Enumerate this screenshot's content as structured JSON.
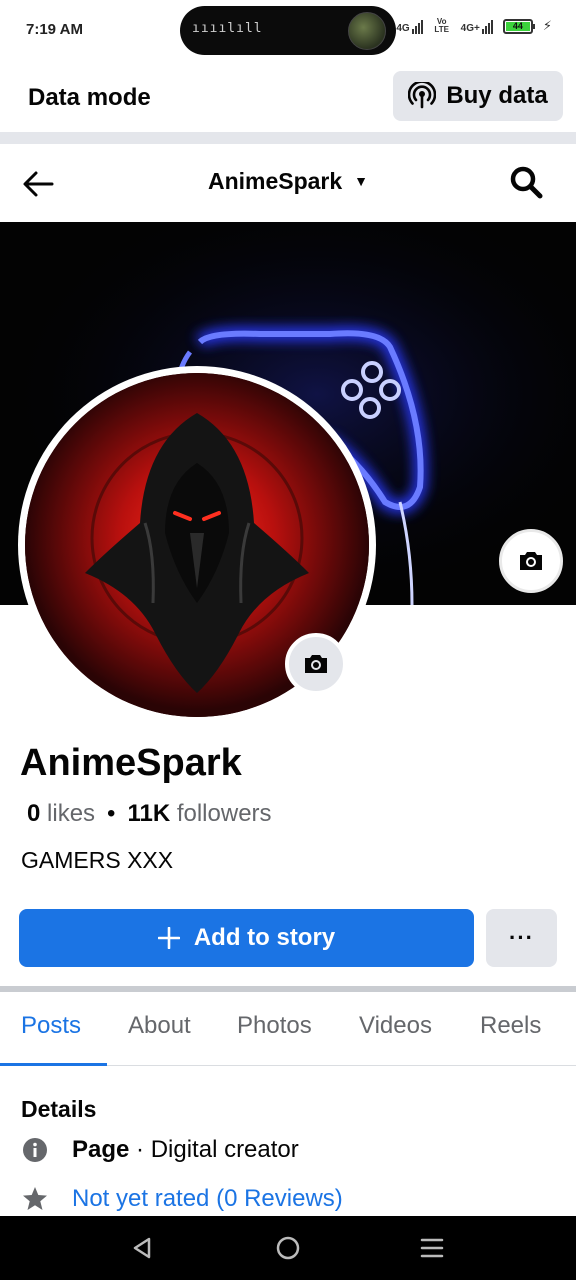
{
  "status_bar": {
    "time": "7:19 AM",
    "pill_indicator": "ıııılıll",
    "net1": "4G",
    "net2": "Vo LTE",
    "net3": "4G+",
    "battery": "44"
  },
  "data_mode": {
    "title": "Data mode",
    "buy_label": "Buy data"
  },
  "header": {
    "title": "AnimeSpark"
  },
  "profile": {
    "name": "AnimeSpark",
    "likes_count": "0",
    "likes_label": "likes",
    "followers_count": "11K",
    "followers_label": "followers",
    "bio": "GAMERS XXX"
  },
  "actions": {
    "add_story": "Add to story",
    "more": "···"
  },
  "tabs": [
    "Posts",
    "About",
    "Photos",
    "Videos",
    "Reels"
  ],
  "details": {
    "title": "Details",
    "page_label": "Page",
    "page_category": " · Digital creator",
    "rating": "Not yet rated (0 Reviews)"
  },
  "colors": {
    "accent": "#1b74e4",
    "neon": "#2b3bff"
  }
}
